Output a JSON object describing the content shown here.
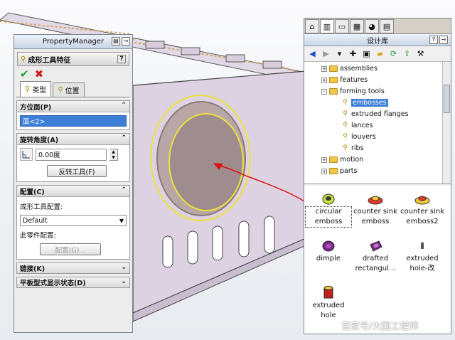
{
  "property_manager": {
    "title": "PropertyManager",
    "feature_title": "成形工具特征",
    "help": "?",
    "tabs": [
      {
        "label": "类型"
      },
      {
        "label": "位置"
      }
    ],
    "face_group": {
      "title": "方位面(P)",
      "selected": "面<2>"
    },
    "rotation_group": {
      "title": "旋转角度(A)",
      "angle_value": "0.00度",
      "flip_button": "反转工具(F)"
    },
    "config_group": {
      "title": "配置(C)",
      "tool_config_label": "成形工具配置:",
      "tool_config_value": "Default",
      "part_config_label": "此零件配置:",
      "config_button": "配置(G)..."
    },
    "link_group": {
      "title": "链接(K)"
    },
    "flat_group": {
      "title": "平板型式显示状态(D)"
    }
  },
  "design_library": {
    "title": "设计库",
    "tree": [
      {
        "label": "assemblies",
        "level": 1,
        "expander": "+",
        "icon": "folder"
      },
      {
        "label": "features",
        "level": 1,
        "expander": "+",
        "icon": "folder"
      },
      {
        "label": "forming tools",
        "level": 1,
        "expander": "-",
        "icon": "folder"
      },
      {
        "label": "embosses",
        "level": 2,
        "icon": "forming-tool",
        "selected": true
      },
      {
        "label": "extruded flanges",
        "level": 2,
        "icon": "forming-tool"
      },
      {
        "label": "lances",
        "level": 2,
        "icon": "forming-tool"
      },
      {
        "label": "louvers",
        "level": 2,
        "icon": "forming-tool"
      },
      {
        "label": "ribs",
        "level": 2,
        "icon": "forming-tool"
      },
      {
        "label": "motion",
        "level": 1,
        "expander": "+",
        "icon": "folder"
      },
      {
        "label": "parts",
        "level": 1,
        "expander": "+",
        "icon": "folder"
      }
    ],
    "items": [
      {
        "label": "circular emboss",
        "color": "#c8e03c",
        "selected": true
      },
      {
        "label": "counter sink emboss",
        "color": "#e23a2a"
      },
      {
        "label": "counter sink emboss2",
        "color": "#f0c83a"
      },
      {
        "label": "dimple",
        "color": "#7a2a8a"
      },
      {
        "label": "drafted rectangul...",
        "color": "#7a2a8a"
      },
      {
        "label": "extruded hole-改",
        "color": "#555555"
      },
      {
        "label": "extruded hole",
        "color": "#c42020"
      }
    ]
  },
  "watermark": "百家号/大国工程师"
}
